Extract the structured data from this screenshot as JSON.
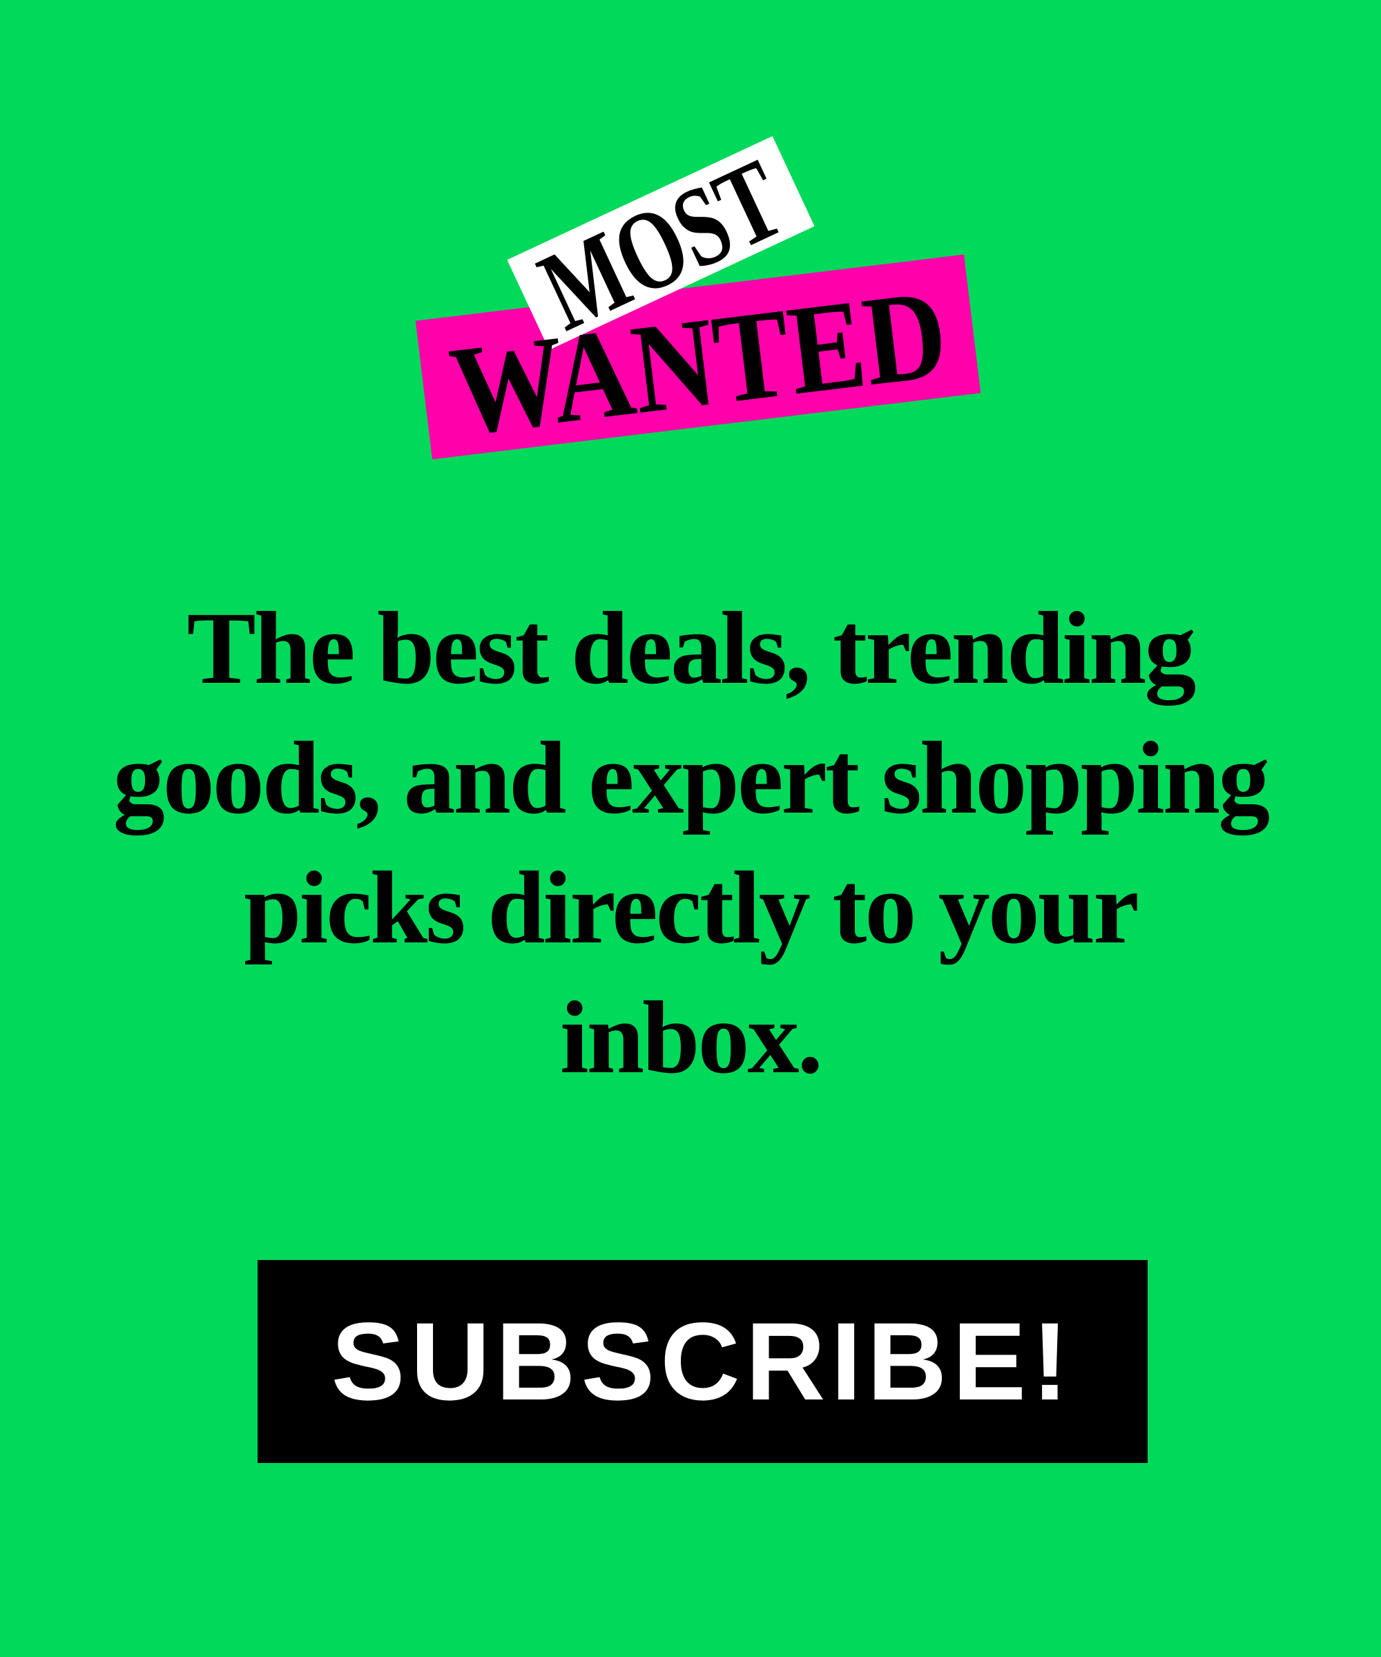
{
  "logo": {
    "top_word": "MOST",
    "bottom_word": "WANTED"
  },
  "headline": "The best deals, trending goods, and expert shopping picks directly to your inbox.",
  "cta": {
    "label": "SUBSCRIBE!"
  },
  "colors": {
    "background": "#00D95A",
    "pink": "#FF00AA",
    "white": "#FFFFFF",
    "black": "#000000"
  }
}
